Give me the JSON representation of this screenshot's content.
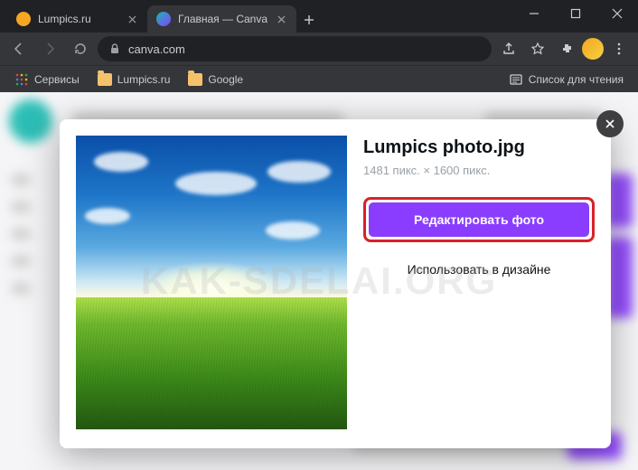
{
  "window": {
    "tabs": [
      {
        "title": "Lumpics.ru",
        "favicon_color": "#f5a623",
        "active": false
      },
      {
        "title": "Главная — Canva",
        "favicon_color": "#17b9b0",
        "active": true
      }
    ],
    "url": "canva.com"
  },
  "bookmarks": {
    "apps": "Сервисы",
    "items": [
      "Lumpics.ru",
      "Google"
    ],
    "reading_list": "Список для чтения"
  },
  "modal": {
    "filename": "Lumpics photo.jpg",
    "dimensions": "1481 пикс. × 1600 пикс.",
    "edit_button": "Редактировать фото",
    "use_button": "Использовать в дизайне"
  },
  "watermark": "KAK-SDELAI.ORG"
}
